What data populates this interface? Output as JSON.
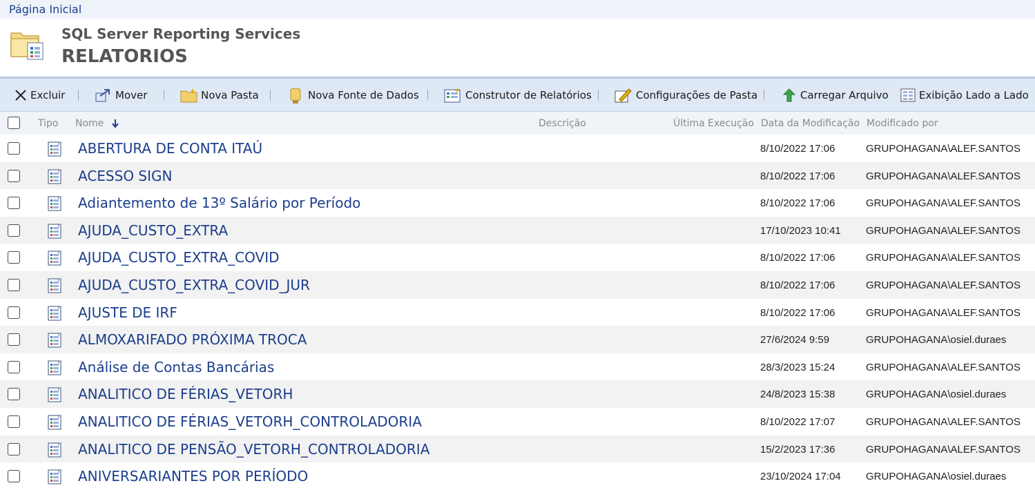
{
  "breadcrumb": {
    "home": "Página Inicial"
  },
  "header": {
    "app_name": "SQL Server Reporting Services",
    "folder_name": "RELATORIOS"
  },
  "toolbar": {
    "delete": "Excluir",
    "move": "Mover",
    "new_folder": "Nova Pasta",
    "new_datasource": "Nova Fonte de Dados",
    "report_builder": "Construtor de Relatórios",
    "folder_settings": "Configurações de Pasta",
    "upload": "Carregar Arquivo",
    "side_by_side": "Exibição Lado a Lado"
  },
  "columns": {
    "type": "Tipo",
    "name": "Nome",
    "description": "Descrição",
    "last_run": "Última Execução",
    "modified_date": "Data da Modificação",
    "modified_by": "Modificado por"
  },
  "rows": [
    {
      "name": "ABERTURA DE CONTA ITAÚ",
      "modified": "8/10/2022 17:06",
      "by": "GRUPOHAGANA\\ALEF.SANTOS"
    },
    {
      "name": "ACESSO SIGN",
      "modified": "8/10/2022 17:06",
      "by": "GRUPOHAGANA\\ALEF.SANTOS"
    },
    {
      "name": "Adiantemento de 13º Salário por Período",
      "modified": "8/10/2022 17:06",
      "by": "GRUPOHAGANA\\ALEF.SANTOS"
    },
    {
      "name": "AJUDA_CUSTO_EXTRA",
      "modified": "17/10/2023 10:41",
      "by": "GRUPOHAGANA\\ALEF.SANTOS"
    },
    {
      "name": "AJUDA_CUSTO_EXTRA_COVID",
      "modified": "8/10/2022 17:06",
      "by": "GRUPOHAGANA\\ALEF.SANTOS"
    },
    {
      "name": "AJUDA_CUSTO_EXTRA_COVID_JUR",
      "modified": "8/10/2022 17:06",
      "by": "GRUPOHAGANA\\ALEF.SANTOS"
    },
    {
      "name": "AJUSTE DE IRF",
      "modified": "8/10/2022 17:06",
      "by": "GRUPOHAGANA\\ALEF.SANTOS"
    },
    {
      "name": "ALMOXARIFADO PRÓXIMA TROCA",
      "modified": "27/6/2024 9:59",
      "by": "GRUPOHAGANA\\osiel.duraes"
    },
    {
      "name": "Análise de Contas Bancárias",
      "modified": "28/3/2023 15:24",
      "by": "GRUPOHAGANA\\ALEF.SANTOS"
    },
    {
      "name": "ANALITICO DE FÉRIAS_VETORH",
      "modified": "24/8/2023 15:38",
      "by": "GRUPOHAGANA\\osiel.duraes"
    },
    {
      "name": "ANALITICO DE FÉRIAS_VETORH_CONTROLADORIA",
      "modified": "8/10/2022 17:07",
      "by": "GRUPOHAGANA\\ALEF.SANTOS"
    },
    {
      "name": "ANALITICO DE PENSÃO_VETORH_CONTROLADORIA",
      "modified": "15/2/2023 17:36",
      "by": "GRUPOHAGANA\\ALEF.SANTOS"
    },
    {
      "name": "ANIVERSARIANTES POR PERÍODO",
      "modified": "23/10/2024 17:04",
      "by": "GRUPOHAGANA\\osiel.duraes"
    }
  ],
  "icons": {
    "delete": "close-x-icon",
    "move": "move-arrow-icon",
    "new_folder": "new-folder-icon",
    "new_datasource": "datasource-icon",
    "report_builder": "report-builder-icon",
    "folder_settings": "settings-pencil-icon",
    "upload": "upload-arrow-icon",
    "side_by_side": "tiles-icon",
    "row": "report-icon"
  },
  "colors": {
    "link": "#1b3e8b",
    "toolbar_bg": "#dfe8f5",
    "accent_line": "#b7c7e4"
  }
}
